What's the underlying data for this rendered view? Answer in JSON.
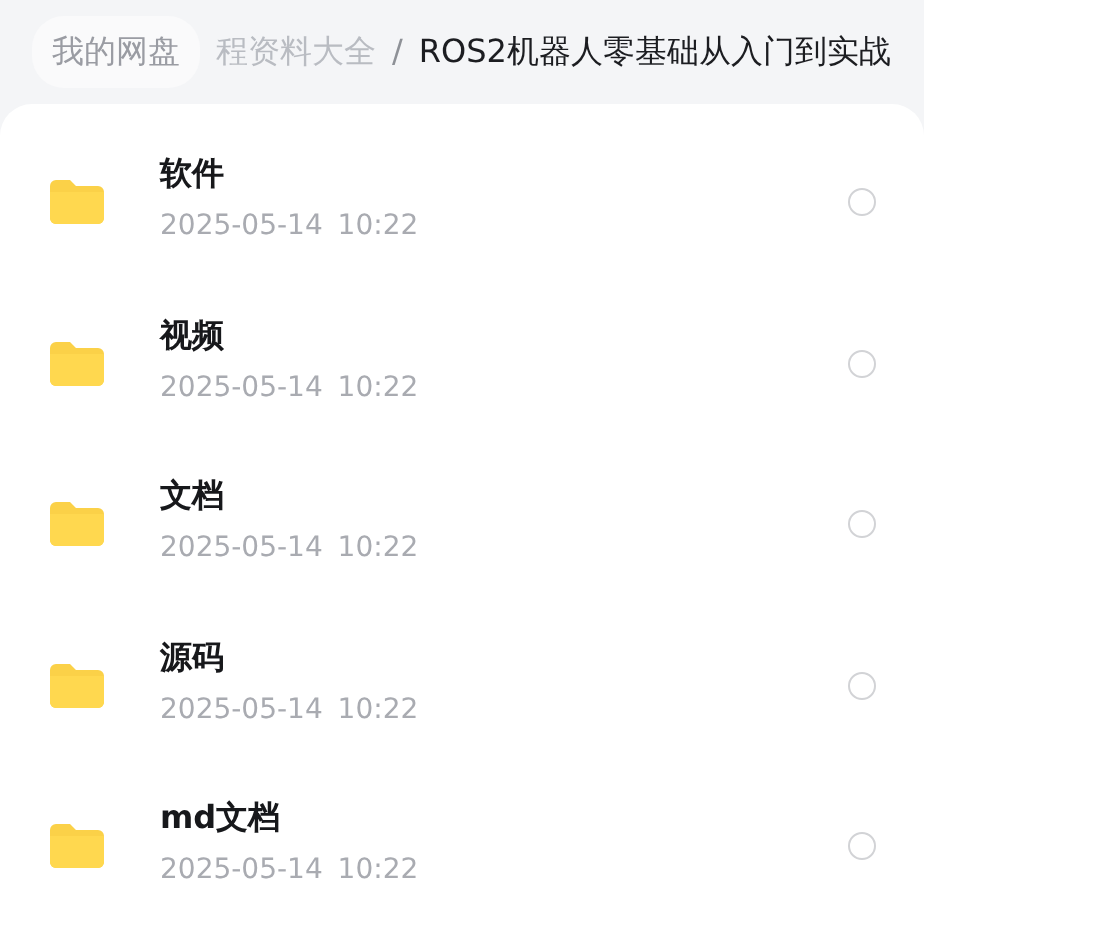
{
  "breadcrumb": [
    {
      "label": "我的网盘",
      "kind": "root"
    },
    {
      "label": "程资料大全",
      "kind": "faded"
    },
    {
      "label": "/",
      "kind": "separator"
    },
    {
      "label": "ROS2机器人零基础从入门到实战",
      "kind": "current"
    }
  ],
  "files": [
    {
      "name": "软件",
      "date": "2025-05-14",
      "time": "10:22",
      "selected": false
    },
    {
      "name": "视频",
      "date": "2025-05-14",
      "time": "10:22",
      "selected": false
    },
    {
      "name": "文档",
      "date": "2025-05-14",
      "time": "10:22",
      "selected": false
    },
    {
      "name": "源码",
      "date": "2025-05-14",
      "time": "10:22",
      "selected": false
    },
    {
      "name": "md文档",
      "date": "2025-05-14",
      "time": "10:22",
      "selected": false
    }
  ]
}
